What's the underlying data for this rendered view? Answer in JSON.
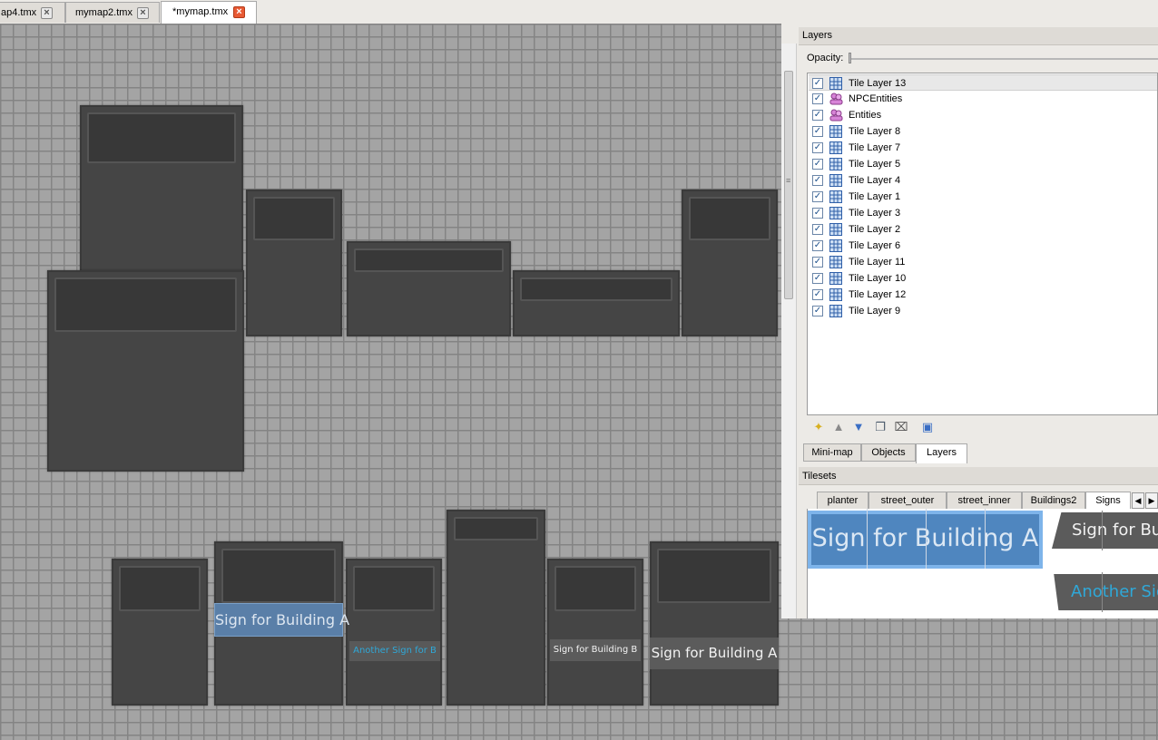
{
  "doc_tabs": [
    {
      "label": "ap4.tmx",
      "active": false
    },
    {
      "label": "mymap2.tmx",
      "active": false
    },
    {
      "label": "*mymap.tmx",
      "active": true
    }
  ],
  "map": {
    "signs": [
      {
        "text": "Sign for Building A",
        "style": "blue"
      },
      {
        "text": "Another Sign for B",
        "style": "cyan"
      },
      {
        "text": "Sign for Building B",
        "style": "gray"
      },
      {
        "text": "Sign for Building A",
        "style": "gray"
      }
    ]
  },
  "layers_panel": {
    "title": "Layers",
    "opacity_label": "Opacity:",
    "layers": [
      {
        "name": "Tile Layer 13",
        "type": "tile",
        "visible": true,
        "selected": true
      },
      {
        "name": "NPCEntities",
        "type": "object",
        "visible": true
      },
      {
        "name": "Entities",
        "type": "object",
        "visible": true
      },
      {
        "name": "Tile Layer 8",
        "type": "tile",
        "visible": true
      },
      {
        "name": "Tile Layer 7",
        "type": "tile",
        "visible": true
      },
      {
        "name": "Tile Layer 5",
        "type": "tile",
        "visible": true
      },
      {
        "name": "Tile Layer 4",
        "type": "tile",
        "visible": true
      },
      {
        "name": "Tile Layer 1",
        "type": "tile",
        "visible": true
      },
      {
        "name": "Tile Layer 3",
        "type": "tile",
        "visible": true
      },
      {
        "name": "Tile Layer 2",
        "type": "tile",
        "visible": true
      },
      {
        "name": "Tile Layer 6",
        "type": "tile",
        "visible": true
      },
      {
        "name": "Tile Layer 11",
        "type": "tile",
        "visible": true
      },
      {
        "name": "Tile Layer 10",
        "type": "tile",
        "visible": true
      },
      {
        "name": "Tile Layer 12",
        "type": "tile",
        "visible": true
      },
      {
        "name": "Tile Layer 9",
        "type": "tile",
        "visible": true
      }
    ],
    "toolbar": [
      "new-layer-icon",
      "move-up-icon",
      "move-down-icon",
      "duplicate-icon",
      "delete-icon",
      "properties-icon"
    ]
  },
  "bottom_tabs": [
    {
      "label": "Mini-map",
      "active": false
    },
    {
      "label": "Objects",
      "active": false
    },
    {
      "label": "Layers",
      "active": true
    }
  ],
  "tilesets": {
    "title": "Tilesets",
    "tabs": [
      {
        "label": "planter",
        "active": false
      },
      {
        "label": "street_outer",
        "active": false
      },
      {
        "label": "street_inner",
        "active": false
      },
      {
        "label": "Buildings2",
        "active": false
      },
      {
        "label": "Signs",
        "active": true
      }
    ],
    "previews": {
      "selected_sign": "Sign for Building A",
      "sign_gray": "Sign for Buildi",
      "sign_cyan": "Another Sign f"
    }
  },
  "colors": {
    "accent_selection": "#7eb4ea",
    "sign_blue": "#5a7fa8",
    "sign_cyan_text": "#2fa8d8",
    "active_close": "#e85a34"
  }
}
